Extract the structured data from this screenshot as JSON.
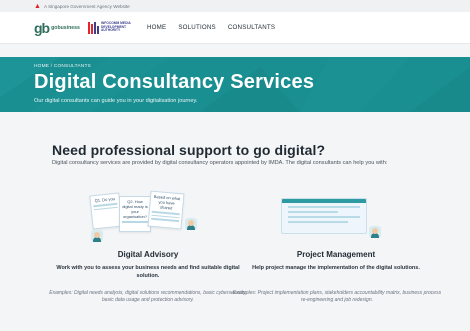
{
  "gov_banner": {
    "text": "A Singapore Government Agency Website"
  },
  "nav": {
    "gb_mark": "gb",
    "gb_word": "gobusiness",
    "imda_text": "INFOCOMM MEDIA DEVELOPMENT AUTHORITY",
    "links": [
      "HOME",
      "SOLUTIONS",
      "CONSULTANTS"
    ]
  },
  "hero": {
    "breadcrumb": "HOME / CONSULTANTS",
    "title": "Digital Consultancy Services",
    "subtitle": "Our digital consultants can guide you in your digitalisation journey."
  },
  "main": {
    "headline": "Need professional support to go digital?",
    "intro": "Digital consultancy services are provided by digital consultancy operators appointed by IMDA. The digital consultants can help you with:",
    "cards": [
      {
        "title": "Digital Advisory",
        "description": "Work with you to assess your business needs and find suitable digital solution.",
        "examples": "Examples: Digital needs analysis, digital solutions recommendations, basic cybersecurity, basic data usage and protection advisory.",
        "notes": [
          "Q1. Do you",
          "Q2. How digital ready is your organisation?",
          "Based on what you have shared"
        ]
      },
      {
        "title": "Project Management",
        "description": "Help project manage the implementation of the digital solutions.",
        "examples": "Examples: Project implementation plans, stakeholders accountability matrix, business process re-engineering and job redesign."
      }
    ]
  },
  "colors": {
    "hero_teal": "#1a8f91",
    "background": "#f4f5f7",
    "text": "#1f2a33"
  }
}
